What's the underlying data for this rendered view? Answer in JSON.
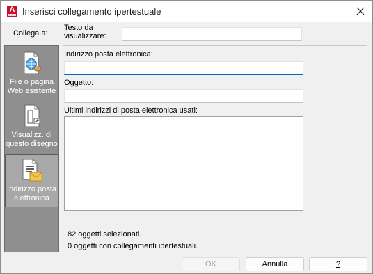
{
  "window": {
    "title": "Inserisci collegamento ipertestuale",
    "app_icon_letter": "A"
  },
  "sidebar": {
    "heading": "Collega a:",
    "items": [
      {
        "label": "File o pagina Web esistente",
        "icon": "web-page-icon",
        "selected": false
      },
      {
        "label": "Visualizz. di questo disegno",
        "icon": "drawing-view-icon",
        "selected": false
      },
      {
        "label": "Indirizzo posta elettronica",
        "icon": "email-address-icon",
        "selected": true
      }
    ]
  },
  "form": {
    "display_text_label": "Testo da visualizzare:",
    "display_text_value": "",
    "email_label": "Indirizzo posta elettronica:",
    "email_value": "",
    "subject_label": "Oggetto:",
    "subject_value": "",
    "recent_label": "Ultimi indirizzi di posta elettronica usati:",
    "recent_items": []
  },
  "status": {
    "selected_objects": "82 oggetti selezionati.",
    "hyperlinked_objects": "0 oggetti con collegamenti ipertestuali."
  },
  "buttons": {
    "ok": "OK",
    "cancel": "Annulla",
    "help": "?"
  },
  "colors": {
    "sidebar_bg": "#8f8f8f",
    "sidebar_selected": "#a8a8a8",
    "focus_accent": "#0067c0",
    "app_icon": "#c8102e"
  }
}
